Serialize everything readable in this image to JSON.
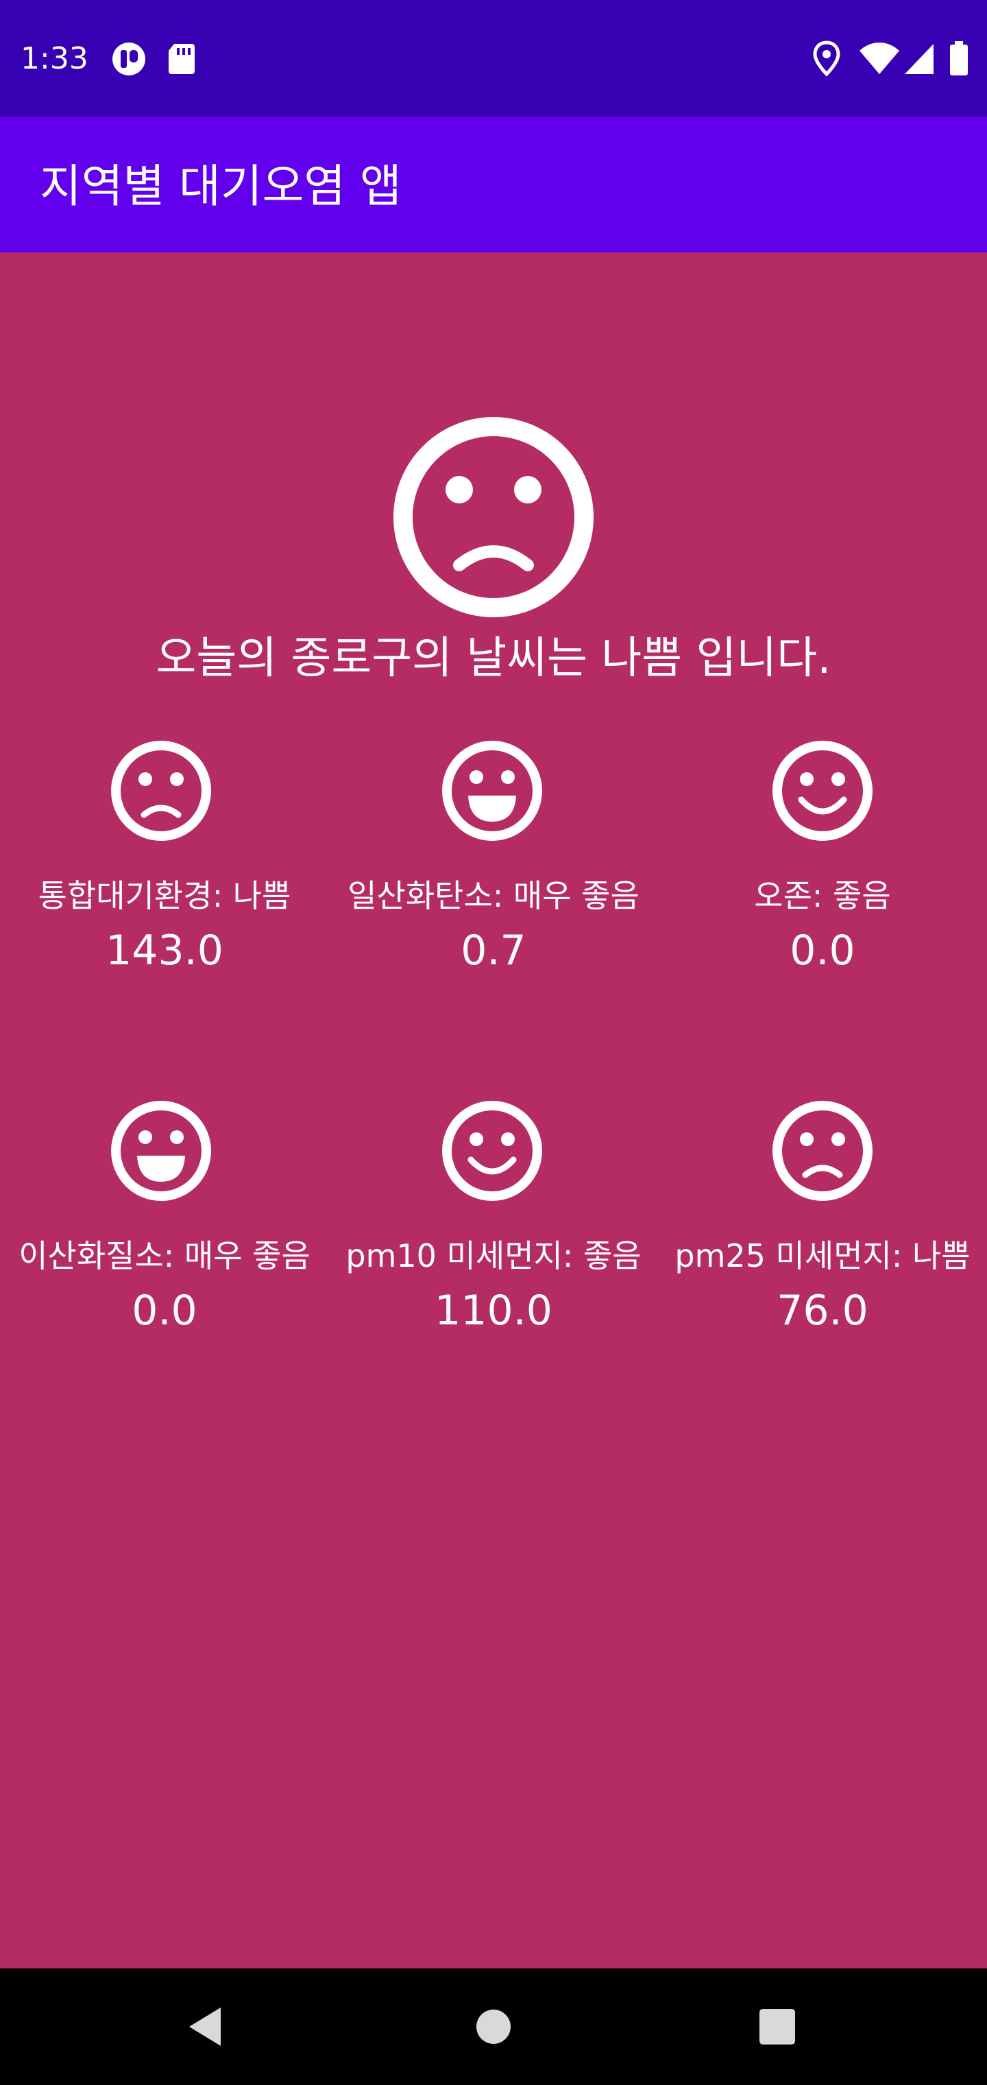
{
  "status_bar": {
    "time": "1:33",
    "icons": [
      "app-notification-icon",
      "sd-card-icon",
      "location-icon",
      "wifi-icon",
      "signal-icon",
      "battery-icon"
    ]
  },
  "app_bar": {
    "title": "지역별 대기오염 앱"
  },
  "main": {
    "face_icon": "sad-face-icon",
    "summary": "오늘의 종로구의 날씨는 나쁨 입니다."
  },
  "items": [
    {
      "label": "통합대기환경: 나쁨",
      "value": "143.0",
      "face": "sad-face-icon"
    },
    {
      "label": "일산화탄소: 매우 좋음",
      "value": "0.7",
      "face": "laughing-face-icon"
    },
    {
      "label": "오존: 좋음",
      "value": "0.0",
      "face": "smiling-face-icon"
    },
    {
      "label": "이산화질소: 매우 좋음",
      "value": "0.0",
      "face": "laughing-face-icon"
    },
    {
      "label": "pm10 미세먼지: 좋음",
      "value": "110.0",
      "face": "smiling-face-icon"
    },
    {
      "label": "pm25 미세먼지: 나쁨",
      "value": "76.0",
      "face": "sad-face-icon"
    }
  ],
  "nav": {
    "back": "back-icon",
    "home": "home-icon",
    "recents": "recents-icon"
  },
  "colors": {
    "status_bar": "#3700b3",
    "app_bar": "#6200ee",
    "background": "#b52b63",
    "nav_bar": "#000000"
  }
}
